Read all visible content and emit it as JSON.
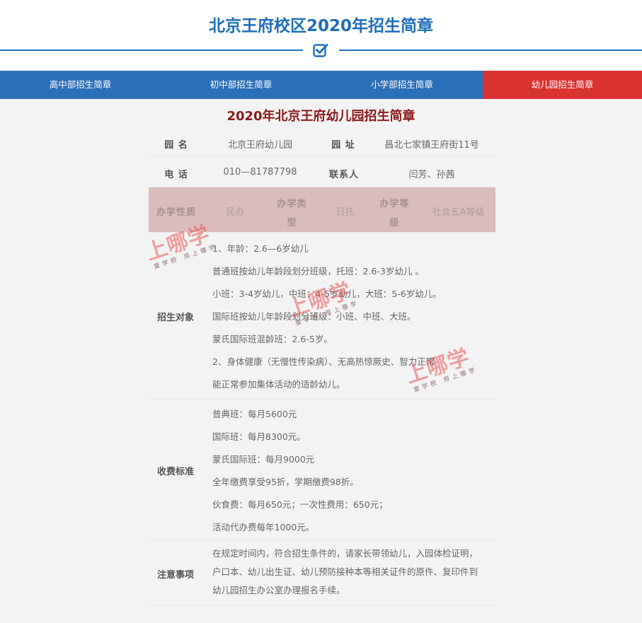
{
  "header": {
    "title": "北京王府校区2020年招生简章",
    "check_icon": "checkbox-check-icon",
    "accent_color": "#1f6fb8"
  },
  "nav": {
    "tabs": [
      {
        "label": "高中部招生简章",
        "active": false
      },
      {
        "label": "初中部招生简章",
        "active": false
      },
      {
        "label": "小学部招生简章",
        "active": false
      },
      {
        "label": "幼儿园招生简章",
        "active": true
      }
    ],
    "bg_color": "#2c6fb9",
    "active_color": "#d93331"
  },
  "section": {
    "title": "2020年北京王府幼儿园招生简章"
  },
  "info": {
    "name_label": "园 名",
    "name_value": "北京王府幼儿园",
    "addr_label": "园 址",
    "addr_value": "昌北七家镇王府街11号",
    "phone_label": "电 话",
    "phone_value": "010—81787798",
    "contact_label": "联系人",
    "contact_value": "闫芳、孙茜",
    "nature_label": "办学性质",
    "nature_value": "民办",
    "type_label_1": "办学类",
    "type_label_2": "型",
    "type_value": "日托",
    "level_label_1": "办学等",
    "level_label_2": "级",
    "level_value": "社会五A等级"
  },
  "enroll": {
    "label": "招生对象",
    "lines": [
      "1、年龄：2.6—6岁幼儿",
      "普通班按幼儿年龄段划分班级，托班：2.6-3岁幼儿 。",
      "小班：3-4岁幼儿，中班：4-5岁幼儿，大班：5-6岁幼儿。",
      "国际班按幼儿年龄段划分班级：小班、中班、大班。",
      "蒙氏国际班混龄班：2.6-5岁。",
      "2、身体健康（无慢性传染病）、无高热惊厥史、智力正常",
      "能正常参加集体活动的适龄幼儿。"
    ]
  },
  "fees": {
    "label": "收费标准",
    "lines": [
      "普典班：每月5600元",
      "国际班：每月8300元。",
      "蒙氏国际班：每月9000元",
      "全年缴费享受95折，学期缴费98折。",
      "伙食费：每月650元；一次性费用：650元；",
      "活动代办费每年1000元。"
    ]
  },
  "notes": {
    "label": "注意事项",
    "lines": [
      "在规定时间内，符合招生条件的，请家长带领幼儿，入园体检证明，",
      "户口本、幼儿出生证、幼儿预防接种本等相关证件的原件、复印件到",
      "幼儿园招生办公室办理报名手续。"
    ]
  },
  "watermark": {
    "main": "上哪学",
    "sub": "查学校 用上哪学"
  }
}
